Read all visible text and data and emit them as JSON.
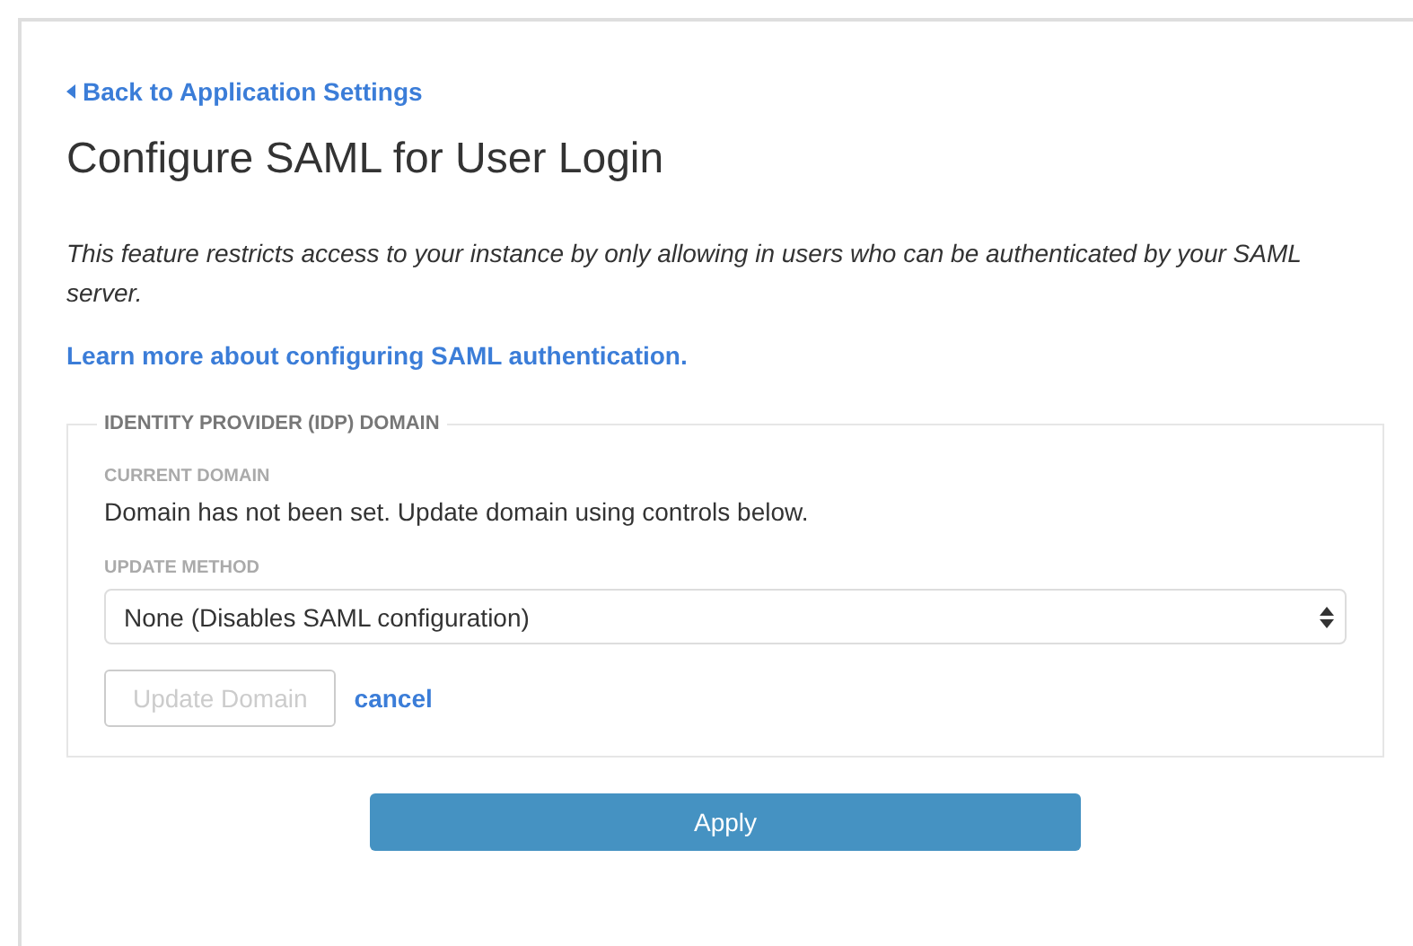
{
  "back_link": {
    "label": "Back to Application Settings"
  },
  "title": "Configure SAML for User Login",
  "description": "This feature restricts access to your instance by only allowing in users who can be authenticated by your SAML server.",
  "learn_more_link": "Learn more about configuring SAML authentication.",
  "idp_section": {
    "legend": "IDENTITY PROVIDER (IDP) DOMAIN",
    "current_domain": {
      "label": "CURRENT DOMAIN",
      "value": "Domain has not been set. Update domain using controls below."
    },
    "update_method": {
      "label": "UPDATE METHOD",
      "value": "None (Disables SAML configuration)"
    },
    "update_button": {
      "label": "Update Domain",
      "disabled": true
    },
    "cancel_link": "cancel"
  },
  "apply_button": {
    "label": "Apply",
    "disabled": false
  }
}
